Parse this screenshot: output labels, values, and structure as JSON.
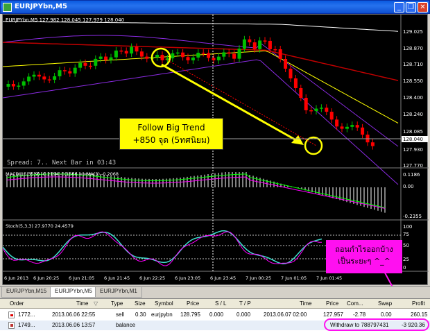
{
  "window": {
    "title": "EURJPYbn,M5",
    "buttons": [
      "minimize",
      "restore",
      "close"
    ]
  },
  "chart": {
    "header_text": "EURJPYbn,M5  127.982 128.045 127.979 128.040",
    "spread_text": "Spread: 7.. Next Bar in 03:43",
    "price_ticks": [
      "129.025",
      "128.870",
      "128.710",
      "128.550",
      "128.400",
      "128.240",
      "128.085",
      "128.040",
      "127.930",
      "127.770"
    ],
    "current_price": "128.040",
    "macd_label": "MACD(15,35,9) -0.2194 -0.1666 =>MA(3) -0.2068",
    "macd_ticks": [
      "0.1186",
      "0.00",
      "-0.2355"
    ],
    "stoch_label": "Stoch(5,3,3) 27.9770 24.4579",
    "stoch_ticks": [
      "100",
      "75",
      "50",
      "25",
      "0"
    ],
    "time_labels": [
      "6 Jun 2013",
      "6 Jun 20:25",
      "6 Jun 21:05",
      "6 Jun 21:45",
      "6 Jun 22:25",
      "6 Jun 23:05",
      "6 Jun 23:45",
      "7 Jun 00:25",
      "7 Jun 01:05",
      "7 Jun 01:45"
    ],
    "annotation": {
      "line1": "Follow Big Trend",
      "line2": "+850 จุด (5ทศนิยม)"
    },
    "withdraw_note": {
      "line1": "ถอนกำไรออกบ้าง",
      "line2": "เป็นระยะๆ ^_^"
    },
    "colors": {
      "bull": "#00c000",
      "bear": "#ff0000",
      "annotation_bg": "#fffc00",
      "note_bg": "#ff10f0"
    }
  },
  "tabs": [
    {
      "label": "EURJPYbn,M15",
      "active": false
    },
    {
      "label": "EURJPYbn,M5",
      "active": true
    },
    {
      "label": "EURJPYbn,M1",
      "active": false
    }
  ],
  "terminal": {
    "headers": [
      "Order",
      "Time",
      "Type",
      "Size",
      "Symbol",
      "Price",
      "S / L",
      "T / P",
      "Time",
      "Price",
      "Com...",
      "Swap",
      "Profit"
    ],
    "rows": [
      {
        "order": "1772...",
        "time": "2013.06.06 22:55",
        "type": "sell",
        "size": "0.30",
        "symbol": "eurjpybn",
        "price": "128.795",
        "sl": "0.000",
        "tp": "0.000",
        "close_time": "2013.06.07 02:00",
        "close_price": "127.957",
        "commission": "-2.78",
        "swap": "0.00",
        "profit": "260.15"
      },
      {
        "order": "1749...",
        "time": "2013.06.06 13:57",
        "type": "balance",
        "comment": "Withdraw to 788797431",
        "profit": "-3 920.36"
      }
    ]
  }
}
